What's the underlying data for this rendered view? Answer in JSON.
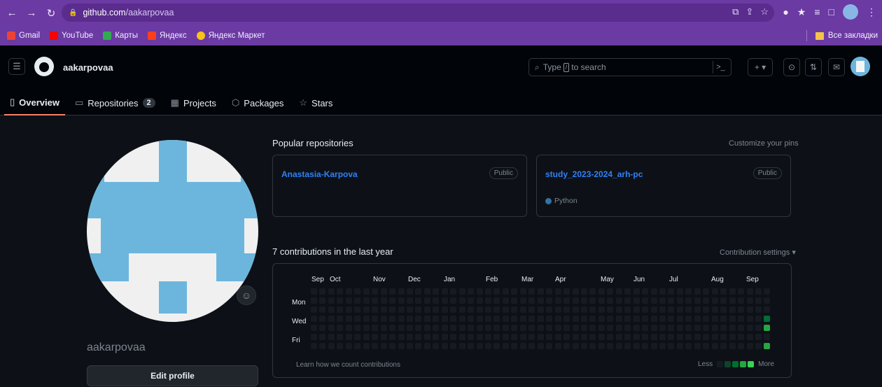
{
  "browser": {
    "url_host": "github.com",
    "url_path": "/aakarpovaa",
    "bookmarks": [
      {
        "label": "Gmail",
        "color": "#ea4335"
      },
      {
        "label": "YouTube",
        "color": "#ff0000"
      },
      {
        "label": "Карты",
        "color": "#34a853"
      },
      {
        "label": "Яндекс",
        "color": "#fc3f1d"
      },
      {
        "label": "Яндекс Маркет",
        "color": "#f8c21b"
      }
    ],
    "bookmarks_folder": "Все закладки"
  },
  "header": {
    "username": "aakarpovaa",
    "search_placeholder_before": "Type",
    "search_slash": "/",
    "search_placeholder_after": "to search",
    "tabs": [
      {
        "label": "Overview",
        "icon": "book-icon"
      },
      {
        "label": "Repositories",
        "icon": "repo-icon",
        "count": "2"
      },
      {
        "label": "Projects",
        "icon": "table-icon"
      },
      {
        "label": "Packages",
        "icon": "package-icon"
      },
      {
        "label": "Stars",
        "icon": "star-icon"
      }
    ]
  },
  "profile": {
    "name": "aakarpovaa",
    "edit_label": "Edit profile"
  },
  "popular": {
    "title": "Popular repositories",
    "customize": "Customize your pins",
    "repos": [
      {
        "name": "Anastasia-Karpova",
        "visibility": "Public",
        "language": ""
      },
      {
        "name": "study_2023-2024_arh-pc",
        "visibility": "Public",
        "language": "Python",
        "language_color": "#3572a5"
      }
    ]
  },
  "contributions": {
    "title": "7 contributions in the last year",
    "settings": "Contribution settings",
    "months": [
      "Sep",
      "Oct",
      "Nov",
      "Dec",
      "Jan",
      "Feb",
      "Mar",
      "Apr",
      "May",
      "Jun",
      "Jul",
      "Aug",
      "Sep"
    ],
    "days": [
      "Mon",
      "Wed",
      "Fri"
    ],
    "learn": "Learn how we count contributions",
    "less": "Less",
    "more": "More",
    "weeks": 53,
    "active_cells": [
      {
        "week": 52,
        "day": 3,
        "level": 2
      },
      {
        "week": 52,
        "day": 4,
        "level": 3
      },
      {
        "week": 52,
        "day": 6,
        "level": 3
      }
    ],
    "colors": {
      "empty": "#161b22",
      "l1": "#0e4429",
      "l2": "#006d32",
      "l3": "#26a641",
      "l4": "#39d353"
    }
  }
}
